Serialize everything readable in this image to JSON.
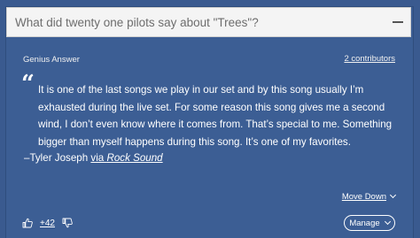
{
  "question": {
    "text": "What did twenty one pilots say about \"Trees\"?"
  },
  "answer": {
    "label": "Genius Answer",
    "contributors": "2 contributors",
    "quote_mark": "“",
    "quote": "It is one of the last songs we play in our set and by this song usually I’m exhausted during the live set. For some reason this song gives me a second wind, I don’t even know where it comes from. That’s special to me. Something bigger than myself happens during this song. It’s one of my favorites.",
    "attribution_prefix": "–Tyler Joseph ",
    "attribution_via": "via ",
    "attribution_source": "Rock Sound",
    "move_down": "Move Down",
    "vote_score": "+42",
    "manage": "Manage"
  },
  "colors": {
    "background": "#3c5e94",
    "question_bar": "#f4f4f4",
    "text": "#ffffff"
  },
  "icons": {
    "collapse": "minus-icon",
    "upvote": "thumbs-up-icon",
    "downvote": "thumbs-down-icon",
    "chevron": "chevron-down-icon"
  }
}
